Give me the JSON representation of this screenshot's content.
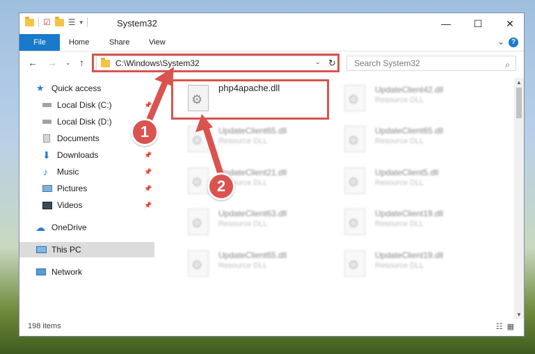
{
  "window": {
    "title": "System32"
  },
  "ribbon": {
    "tabs": [
      "File",
      "Home",
      "Share",
      "View"
    ]
  },
  "navigation": {
    "address_path": "C:\\Windows\\System32",
    "search_placeholder": "Search System32"
  },
  "sidebar": {
    "items": [
      {
        "label": "Quick access",
        "icon": "star-icon"
      },
      {
        "label": "Local Disk (C:)",
        "icon": "drive-icon",
        "pinned": true
      },
      {
        "label": "Local Disk (D:)",
        "icon": "drive-icon"
      },
      {
        "label": "Documents",
        "icon": "documents-icon"
      },
      {
        "label": "Downloads",
        "icon": "downloads-icon",
        "pinned": true
      },
      {
        "label": "Music",
        "icon": "music-icon",
        "pinned": true
      },
      {
        "label": "Pictures",
        "icon": "pictures-icon",
        "pinned": true
      },
      {
        "label": "Videos",
        "icon": "videos-icon",
        "pinned": true
      },
      {
        "label": "OneDrive",
        "icon": "cloud-icon"
      },
      {
        "label": "This PC",
        "icon": "computer-icon",
        "selected": true
      },
      {
        "label": "Network",
        "icon": "network-icon"
      }
    ]
  },
  "files": {
    "highlighted": {
      "name": "php4apache.dll"
    },
    "blurred": [
      {
        "name": "UpdateClient42.dll",
        "type": "Resource DLL"
      },
      {
        "name": "UpdateClient65.dll",
        "type": "Resource DLL"
      },
      {
        "name": "UpdateClient65.dll",
        "type": "Resource DLL"
      },
      {
        "name": "UpdateClient21.dll",
        "type": "Resource DLL"
      },
      {
        "name": "UpdateClient5.dll",
        "type": "Resource DLL"
      },
      {
        "name": "UpdateClient63.dll",
        "type": "Resource DLL"
      },
      {
        "name": "UpdateClient19.dll",
        "type": "Resource DLL"
      },
      {
        "name": "UpdateClient65.dll",
        "type": "Resource DLL"
      },
      {
        "name": "UpdateClient19.dll",
        "type": "Resource DLL"
      }
    ]
  },
  "status": {
    "item_count": "198 items"
  },
  "annotations": {
    "step1": "1",
    "step2": "2"
  },
  "colors": {
    "accent": "#1979ca",
    "annotation_red": "#d9534f"
  }
}
